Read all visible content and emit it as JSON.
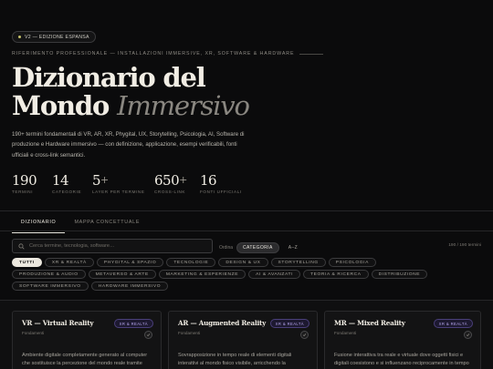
{
  "edition": {
    "label": "V2 — EDIZIONE ESPANSA"
  },
  "subtitle": "RIFERIMENTO PROFESSIONALE — INSTALLAZIONI IMMERSIVE, XR, SOFTWARE & HARDWARE",
  "title": {
    "line1": "Dizionario del",
    "line2_main": "Mondo",
    "line2_accent": "Immersivo"
  },
  "intro": "190+ termini fondamentali di VR, AR, XR, Phygital, UX, Storytelling, Psicologia, AI, Software di produzione e Hardware immersivo — con definizione, applicazione, esempi verificabili, fonti ufficiali e cross-link semantici.",
  "stats": [
    {
      "num": "190",
      "plus": "",
      "label": "TERMINI"
    },
    {
      "num": "14",
      "plus": "",
      "label": "CATEGORIE"
    },
    {
      "num": "5",
      "plus": "+",
      "label": "LAYER PER TERMINE"
    },
    {
      "num": "650",
      "plus": "+",
      "label": "CROSS-LINK"
    },
    {
      "num": "16",
      "plus": "",
      "label": "FONTI UFFICIALI"
    }
  ],
  "tabs": [
    {
      "label": "DIZIONARIO",
      "active": true
    },
    {
      "label": "MAPPA CONCETTUALE",
      "active": false
    }
  ],
  "search": {
    "placeholder": "Cerca termine, tecnologia, software…",
    "value": ""
  },
  "sort": {
    "label": "Ordina",
    "options": [
      "CATEGORIA",
      "A–Z"
    ],
    "selected": "CATEGORIA"
  },
  "count": "190 / 190 termini",
  "chips": [
    {
      "label": "TUTTI",
      "active": true
    },
    {
      "label": "XR & REALTÀ",
      "active": false
    },
    {
      "label": "PHYGITAL & SPAZIO",
      "active": false
    },
    {
      "label": "TECNOLOGIE",
      "active": false
    },
    {
      "label": "DESIGN & UX",
      "active": false
    },
    {
      "label": "STORYTELLING",
      "active": false
    },
    {
      "label": "PSICOLOGIA",
      "active": false
    },
    {
      "label": "PRODUZIONE & AUDIO",
      "active": false
    },
    {
      "label": "METAVERSO & ARTE",
      "active": false
    },
    {
      "label": "MARKETING & ESPERIENZE",
      "active": false
    },
    {
      "label": "AI & AVANZATI",
      "active": false
    },
    {
      "label": "TEORIA & RICERCA",
      "active": false
    },
    {
      "label": "DISTRIBUZIONE",
      "active": false
    },
    {
      "label": "SOFTWARE IMMERSIVO",
      "active": false
    },
    {
      "label": "HARDWARE IMMERSIVO",
      "active": false
    }
  ],
  "cards": [
    {
      "term": "VR — Virtual Reality",
      "category": "Fondamenti",
      "tag": "XR & REALTÀ",
      "definition": "Ambiente digitale completamente generato al computer che sostituisce la percezione del mondo reale tramite visori, isolando l'utente dallo spazio fisico."
    },
    {
      "term": "AR — Augmented Reality",
      "category": "Fondamenti",
      "tag": "XR & REALTÀ",
      "definition": "Sovrapposizione in tempo reale di elementi digitali interattivi al mondo fisico visibile, arricchendo la percezione senza sostituirla."
    },
    {
      "term": "MR — Mixed Reality",
      "category": "Fondamenti",
      "tag": "XR & REALTÀ",
      "definition": "Fusione interattiva tra reale e virtuale dove oggetti fisici e digitali coesistono e si influenzano reciprocamente in tempo reale."
    }
  ],
  "colors": {
    "background": "#0b0b0c",
    "accent_tag": "#b7a6ef",
    "chip_active": "#ece8df"
  }
}
